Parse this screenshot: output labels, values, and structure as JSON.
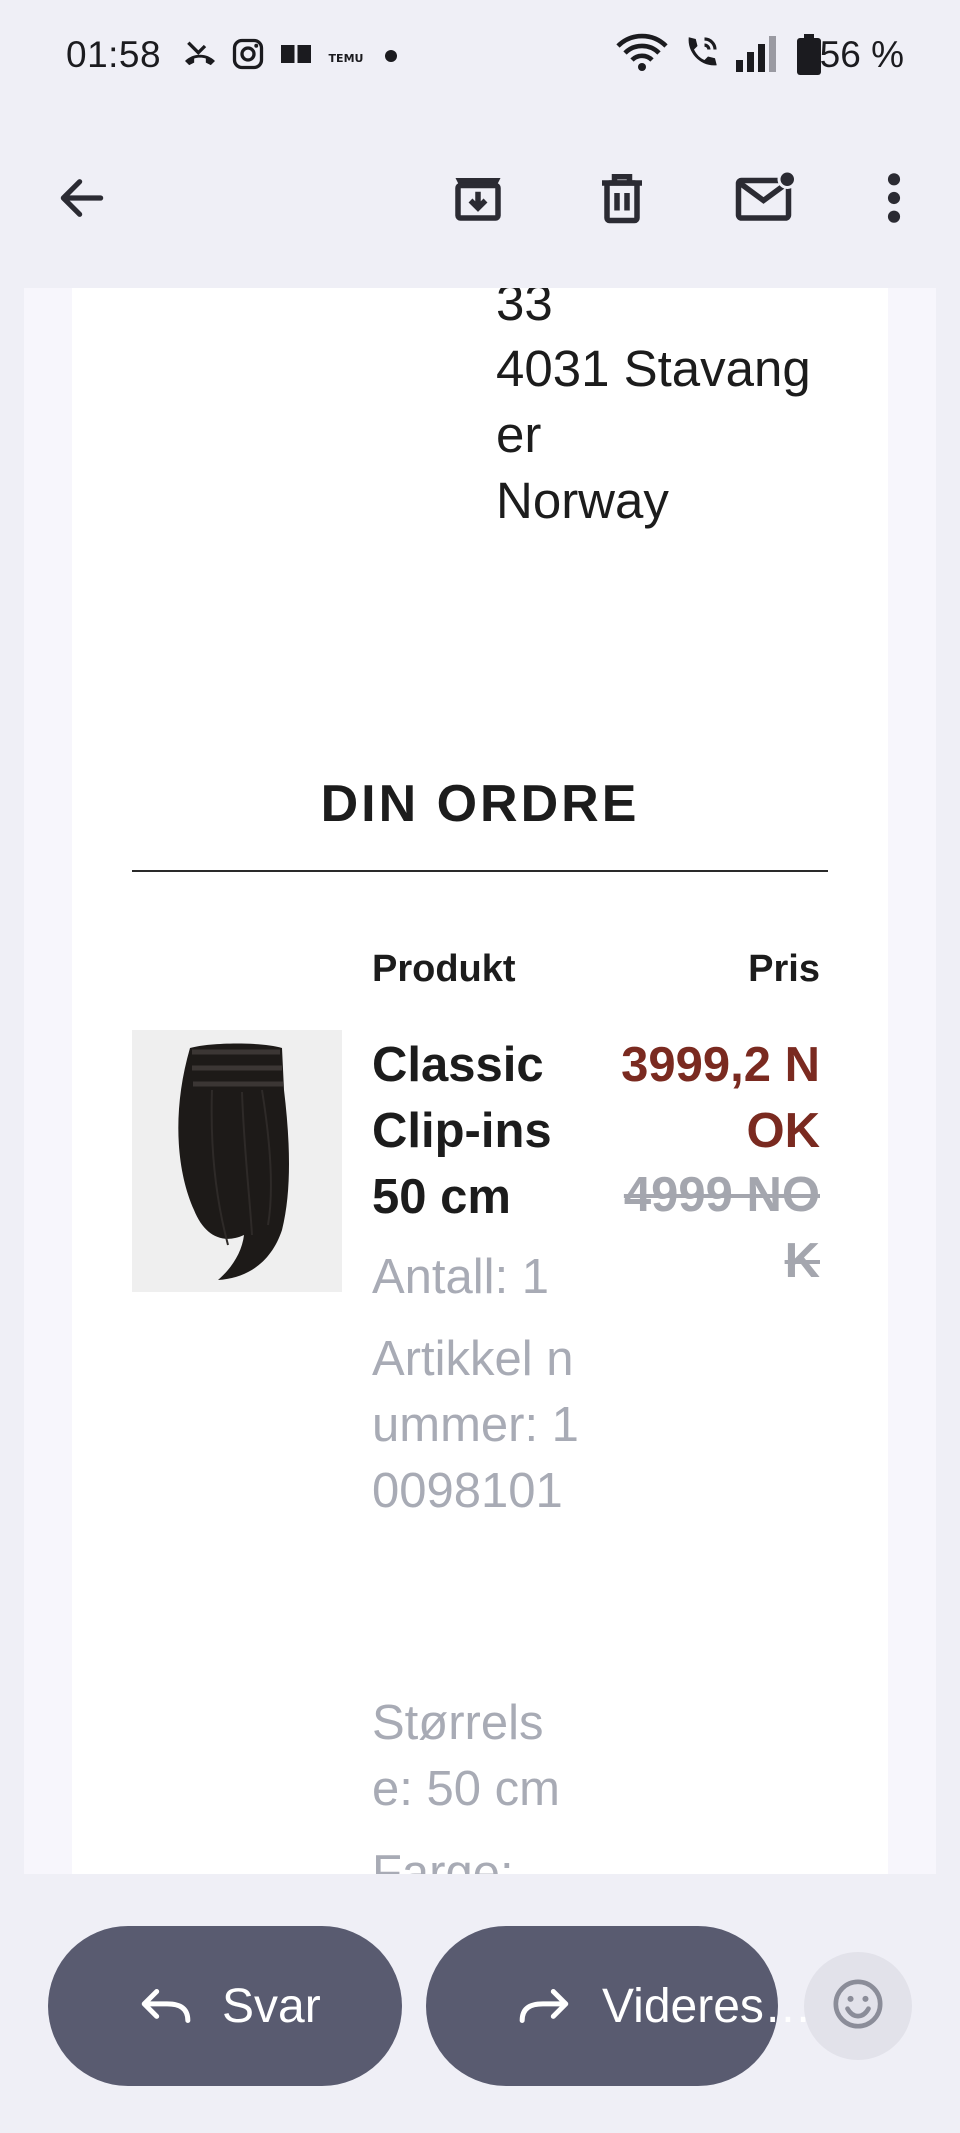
{
  "status_bar": {
    "time": "01:58",
    "battery_percent": "56 %",
    "notification_icons": [
      "missed-call-icon",
      "instagram-icon",
      "reading-icon",
      "temu-icon",
      "dot-icon"
    ],
    "system_icons": [
      "wifi-icon",
      "wifi-call-icon",
      "signal-icon",
      "battery-icon"
    ]
  },
  "toolbar": {
    "actions": [
      "back-arrow-icon",
      "archive-icon",
      "delete-icon",
      "mark-unread-icon",
      "more-vert-icon"
    ]
  },
  "email": {
    "address_lines": [
      "33",
      "4031 Stavanger",
      "Norway"
    ],
    "order": {
      "title": "DIN ORDRE",
      "column_product": "Produkt",
      "column_price": "Pris",
      "item": {
        "name": "Classic Clip-ins 50 cm",
        "price_now": "3999,2 NOK",
        "price_old": "4999 NOK",
        "quantity": "Antall: 1",
        "article_number": "Artikkel nummer: 10098101",
        "size": "Størrelse: 50 cm",
        "color_label": "Farge:"
      }
    }
  },
  "bottom_bar": {
    "reply_label": "Svar",
    "forward_label": "Videres…"
  },
  "colors": {
    "accent_price": "#7a2a20",
    "muted_text": "#a8abb5",
    "pill": "#595b70",
    "background": "#efeff6"
  }
}
